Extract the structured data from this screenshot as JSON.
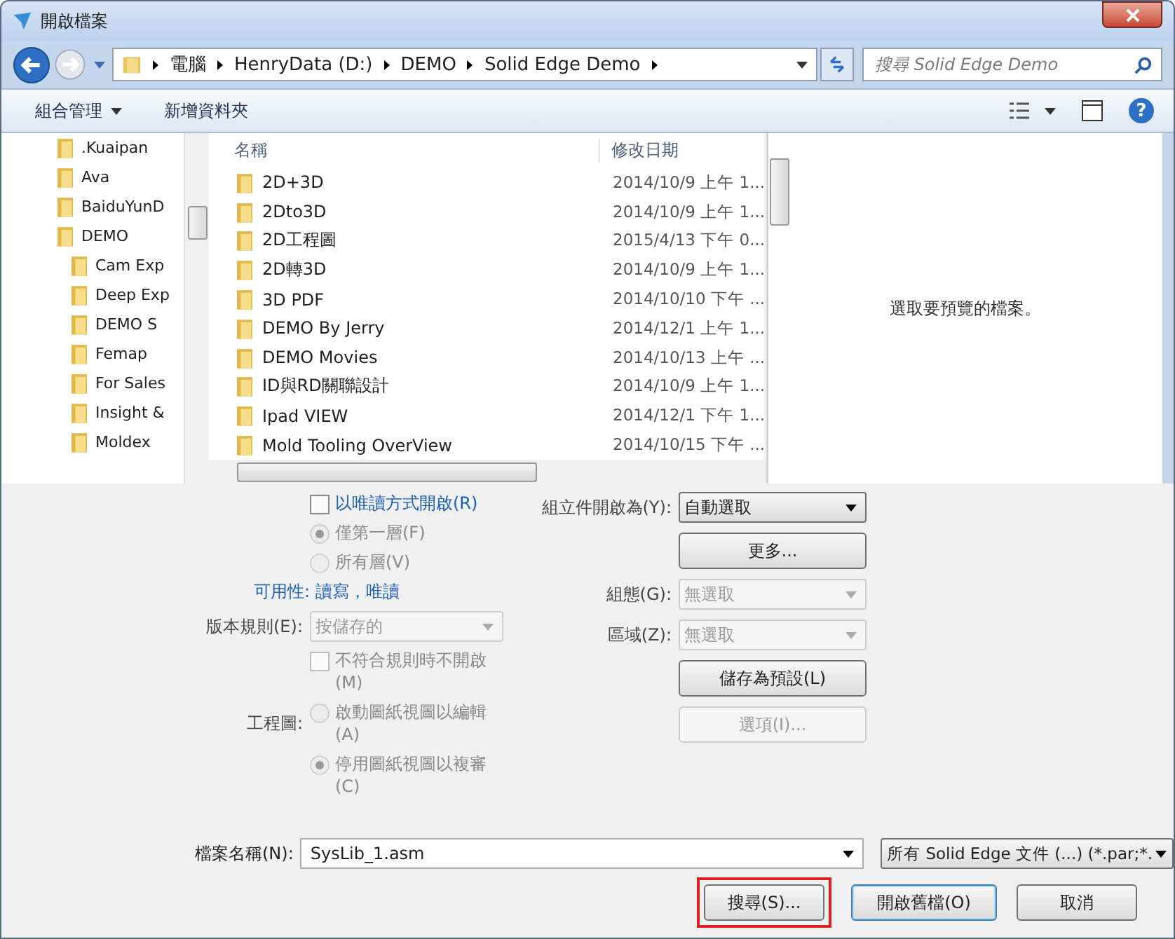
{
  "window": {
    "title": "開啟檔案"
  },
  "address": {
    "crumbs": [
      "電腦",
      "HenryData (D:)",
      "DEMO",
      "Solid Edge Demo"
    ],
    "search_placeholder": "搜尋 Solid Edge Demo"
  },
  "toolbar": {
    "items": [
      "組合管理",
      "新增資料夾"
    ],
    "help": "?"
  },
  "nav": {
    "items": [
      {
        "name": ".Kuaipan"
      },
      {
        "name": "Ava"
      },
      {
        "name": "BaiduYunD"
      },
      {
        "name": "DEMO",
        "children": [
          {
            "name": "Cam Exp"
          },
          {
            "name": "Deep Exp"
          },
          {
            "name": "DEMO S"
          },
          {
            "name": "Femap"
          },
          {
            "name": "For Sales"
          },
          {
            "name": "Insight &"
          },
          {
            "name": "Moldex"
          }
        ]
      }
    ]
  },
  "files": {
    "columns": [
      "名稱",
      "修改日期"
    ],
    "rows": [
      {
        "name": "2D+3D",
        "date": "2014/10/9 上午 1..."
      },
      {
        "name": "2Dto3D",
        "date": "2014/10/9 上午 1..."
      },
      {
        "name": "2D工程圖",
        "date": "2015/4/13 下午 0..."
      },
      {
        "name": "2D轉3D",
        "date": "2014/10/9 上午 1..."
      },
      {
        "name": "3D PDF",
        "date": "2014/10/10 下午 ..."
      },
      {
        "name": "DEMO By Jerry",
        "date": "2014/12/1 上午 1..."
      },
      {
        "name": "DEMO Movies",
        "date": "2014/10/13 上午 ..."
      },
      {
        "name": "ID與RD關聯設計",
        "date": "2014/10/9 上午 1..."
      },
      {
        "name": "Ipad VIEW",
        "date": "2014/12/1 下午 1..."
      },
      {
        "name": "Mold Tooling OverView",
        "date": "2014/10/15 下午 ..."
      }
    ]
  },
  "preview": {
    "message": "選取要預覽的檔案。"
  },
  "options": {
    "left": [
      {
        "kind": "checkbox",
        "label": "以唯讀方式開啟(R)",
        "checked": false,
        "disabled": false
      },
      {
        "kind": "radio",
        "label": "僅第一層(F)",
        "selected": true,
        "disabled": true
      },
      {
        "kind": "radio",
        "label": "所有層(V)",
        "selected": false,
        "disabled": true
      },
      {
        "kind": "info",
        "label": "可用性: 讀寫，唯讀"
      },
      {
        "kind": "select",
        "caption": "版本規則(E):",
        "value": "按儲存的",
        "disabled": true
      },
      {
        "kind": "checkbox",
        "label": "不符合規則時不開啟(M)",
        "checked": false,
        "disabled": true
      },
      {
        "kind": "radio",
        "caption": "工程圖:",
        "label": "啟動圖紙視圖以編輯(A)",
        "selected": false,
        "disabled": true
      },
      {
        "kind": "radio",
        "label": "停用圖紙視圖以複審(C)",
        "selected": true,
        "disabled": true
      }
    ],
    "right": [
      {
        "kind": "select",
        "caption": "組立件開啟為(Y):",
        "value": "自動選取",
        "disabled": false
      },
      {
        "kind": "button",
        "label": "更多...",
        "disabled": false
      },
      {
        "kind": "select",
        "caption": "組態(G):",
        "value": "無選取",
        "disabled": true
      },
      {
        "kind": "select",
        "caption": "區域(Z):",
        "value": "無選取",
        "disabled": true
      },
      {
        "kind": "button",
        "label": "儲存為預設(L)",
        "disabled": false
      },
      {
        "kind": "button",
        "label": "選項(I)...",
        "disabled": true
      }
    ]
  },
  "bottom": {
    "filename_label": "檔案名稱(N):",
    "filename": "SysLib_1.asm",
    "filter": "所有 Solid Edge 文件 (...) (*.par;*.",
    "buttons": [
      {
        "label": "搜尋(S)...",
        "highlighted": true,
        "default": false
      },
      {
        "label": "開啟舊檔(O)",
        "highlighted": false,
        "default": true
      },
      {
        "label": "取消",
        "highlighted": false,
        "default": false
      }
    ]
  }
}
